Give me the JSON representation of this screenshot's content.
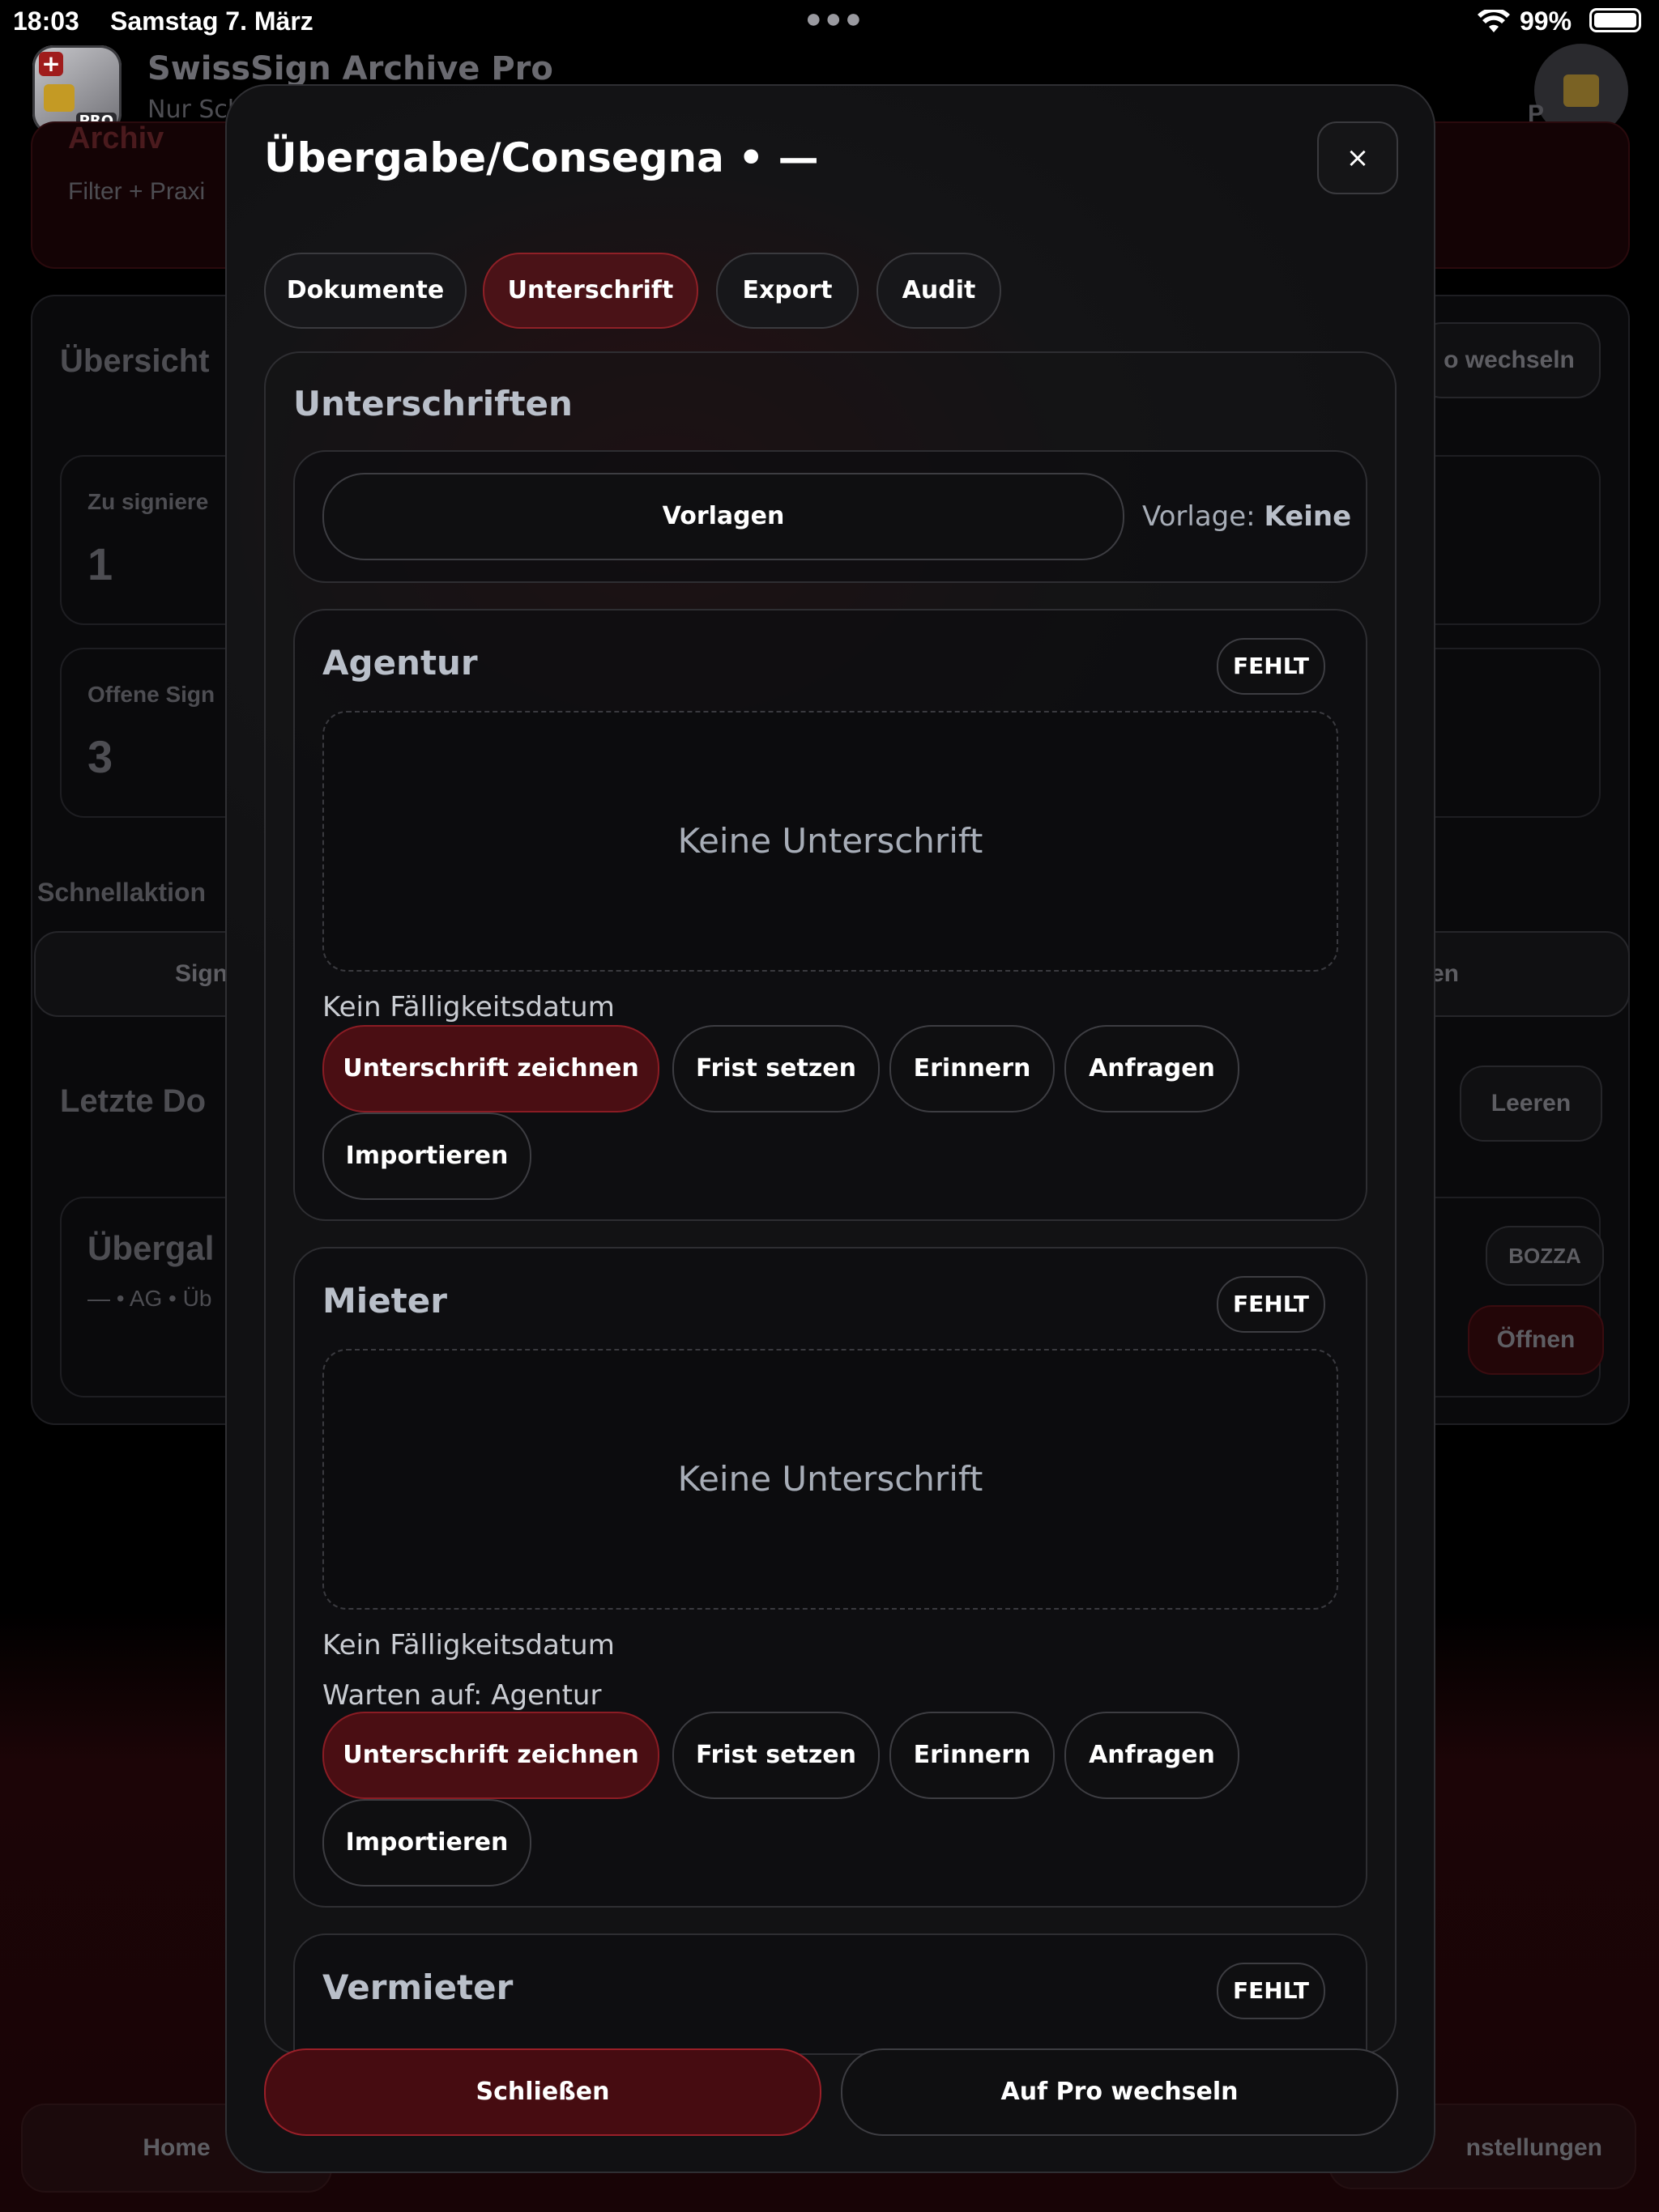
{
  "status_bar": {
    "time": "18:03",
    "date": "Samstag 7. März",
    "battery": "99%"
  },
  "background": {
    "app_title": "SwissSign Archive Pro",
    "app_subtitle": "Nur Sch",
    "section_archiv": "Archiv",
    "archiv_sub": "Filter + Praxi",
    "overview_title": "Übersicht",
    "switch_pro_partial": "o wechseln",
    "stat1_label": "Zu signiere",
    "stat1_value": "1",
    "stat2_label": "Offene Sign",
    "stat2_value": "3",
    "quick_actions": "Schnellaktion",
    "quick_btn_left": "Sign",
    "quick_btn_right": "en",
    "recent_docs": "Letzte Do",
    "clear_btn": "Leeren",
    "doc_title": "Übergal",
    "doc_meta": "— • AG • Üb",
    "doc_badge": "BOZZA",
    "doc_open": "Öffnen",
    "nav_home": "Home",
    "nav_settings": "nstellungen",
    "pro_badge": "P"
  },
  "modal": {
    "title": "Übergabe/Consegna • —",
    "close_label": "×",
    "tabs": [
      {
        "label": "Dokumente"
      },
      {
        "label": "Unterschrift"
      },
      {
        "label": "Export"
      },
      {
        "label": "Audit"
      }
    ],
    "signatures_heading": "Unterschriften",
    "templates_button": "Vorlagen",
    "template_prefix": "Vorlage:",
    "template_value": "Keine",
    "signers": [
      {
        "name": "Agentur",
        "status": "FEHLT",
        "placeholder": "Keine Unterschrift",
        "due_date": "Kein Fälligkeitsdatum",
        "waiting": "",
        "actions": {
          "sign": "Unterschrift zeichnen",
          "deadline": "Frist setzen",
          "remind": "Erinnern",
          "request": "Anfragen",
          "import": "Importieren"
        }
      },
      {
        "name": "Mieter",
        "status": "FEHLT",
        "placeholder": "Keine Unterschrift",
        "due_date": "Kein Fälligkeitsdatum",
        "waiting": "Warten auf: Agentur",
        "actions": {
          "sign": "Unterschrift zeichnen",
          "deadline": "Frist setzen",
          "remind": "Erinnern",
          "request": "Anfragen",
          "import": "Importieren"
        }
      },
      {
        "name": "Vermieter",
        "status": "FEHLT"
      }
    ],
    "footer": {
      "close": "Schließen",
      "upgrade": "Auf Pro wechseln"
    }
  }
}
